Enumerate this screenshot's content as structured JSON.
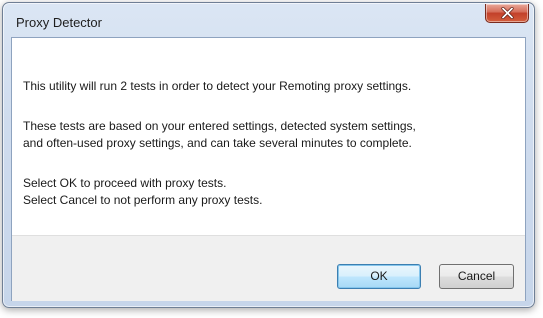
{
  "window": {
    "title": "Proxy Detector",
    "close_icon": "close-icon"
  },
  "message": {
    "paragraph1": "This utility will run 2 tests in order to detect your Remoting proxy settings.",
    "paragraph2": [
      "These tests are based on your entered settings, detected system settings,",
      "and often-used proxy settings, and can take several minutes to complete."
    ],
    "paragraph3": [
      "Select OK to proceed with proxy tests.",
      "Select Cancel to not perform any proxy tests."
    ]
  },
  "buttons": {
    "ok_label": "OK",
    "cancel_label": "Cancel"
  },
  "colors": {
    "close_button": "#c2402a",
    "default_button_border": "#3c7fb1",
    "footer_background": "#f0f0f0"
  }
}
